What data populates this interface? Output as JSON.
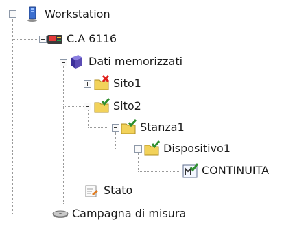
{
  "tree": {
    "workstation": {
      "label": "Workstation",
      "icon": "workstation-icon",
      "expanded": true
    },
    "device": {
      "label": "C.A 6116",
      "icon": "instrument-icon",
      "expanded": true
    },
    "stored_data": {
      "label": "Dati memorizzati",
      "icon": "book-icon",
      "expanded": true
    },
    "site1": {
      "label": "Sito1",
      "icon": "folder-error-icon",
      "expanded": false
    },
    "site2": {
      "label": "Sito2",
      "icon": "folder-check-icon",
      "expanded": true
    },
    "room1": {
      "label": "Stanza1",
      "icon": "folder-check-icon",
      "expanded": true
    },
    "device1": {
      "label": "Dispositivo1",
      "icon": "folder-check-icon",
      "expanded": true
    },
    "continuity": {
      "label": "CONTINUITA",
      "icon": "measurement-check-icon"
    },
    "state": {
      "label": "Stato",
      "icon": "status-icon"
    },
    "campaign": {
      "label": "Campagna di misura",
      "icon": "campaign-disk-icon"
    }
  },
  "colors": {
    "folder": "#f2d25a",
    "check": "#2f8f2f",
    "error": "#e0201b",
    "book": "#5a4bb3"
  }
}
